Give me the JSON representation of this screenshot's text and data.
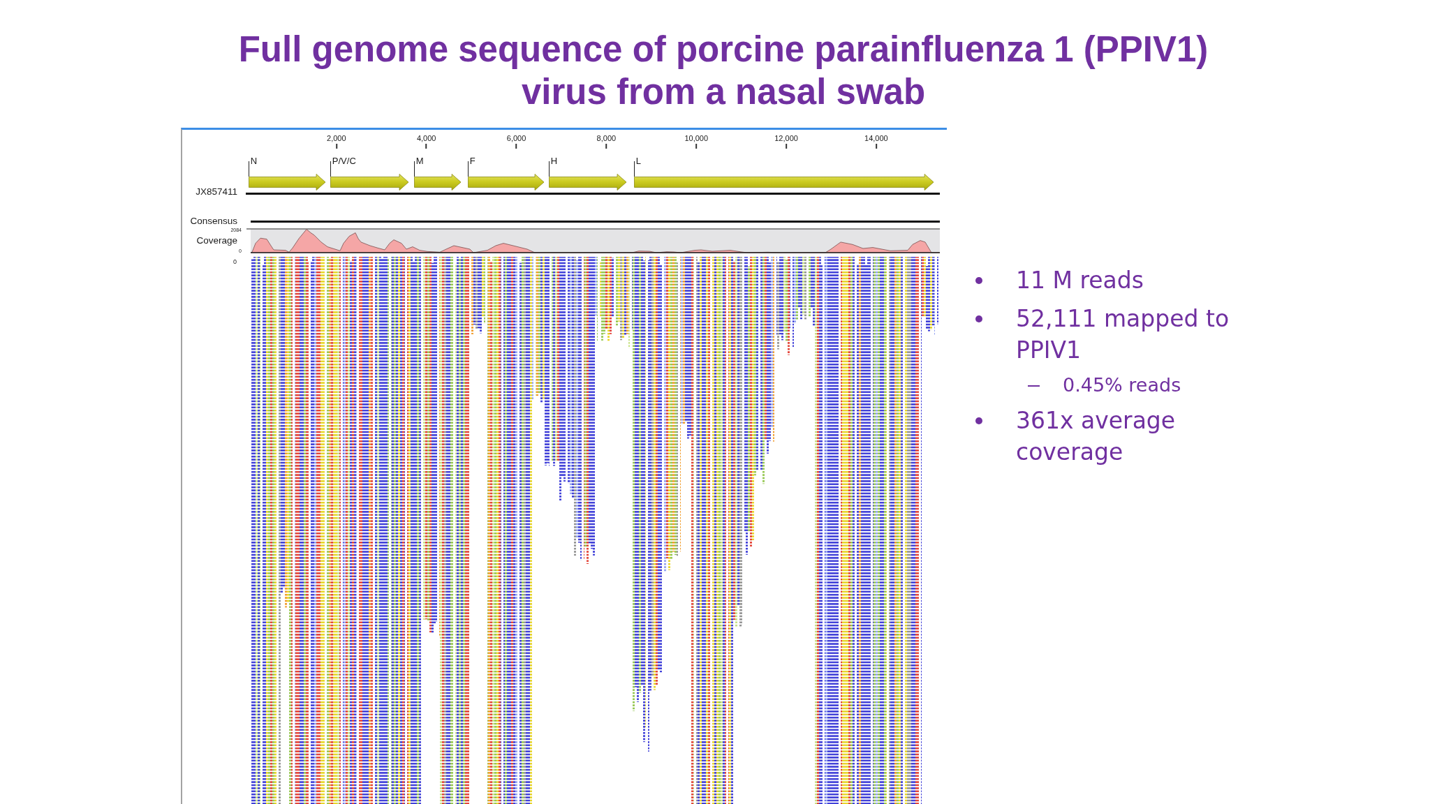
{
  "title": "Full genome sequence of porcine parainfluenza 1 (PPIV1) virus from a nasal swab",
  "viewer": {
    "ruler": {
      "ticks": [
        "2,000",
        "4,000",
        "6,000",
        "8,000",
        "10,000",
        "12,000",
        "14,000"
      ]
    },
    "reference": {
      "name": "JX857411",
      "genes": [
        {
          "label": "N"
        },
        {
          "label": "P/V/C"
        },
        {
          "label": "M"
        },
        {
          "label": "F"
        },
        {
          "label": "H"
        },
        {
          "label": "L"
        }
      ]
    },
    "consensus": {
      "label": "Consensus"
    },
    "coverage": {
      "label": "Coverage",
      "max_label": "2084",
      "min_label": "0"
    },
    "reads": {
      "label": "0"
    }
  },
  "bullets": [
    {
      "text": "11 M reads"
    },
    {
      "text": "52,111 mapped to PPIV1",
      "children": [
        {
          "text": "0.45% reads"
        }
      ]
    },
    {
      "text": "361x average coverage"
    }
  ]
}
